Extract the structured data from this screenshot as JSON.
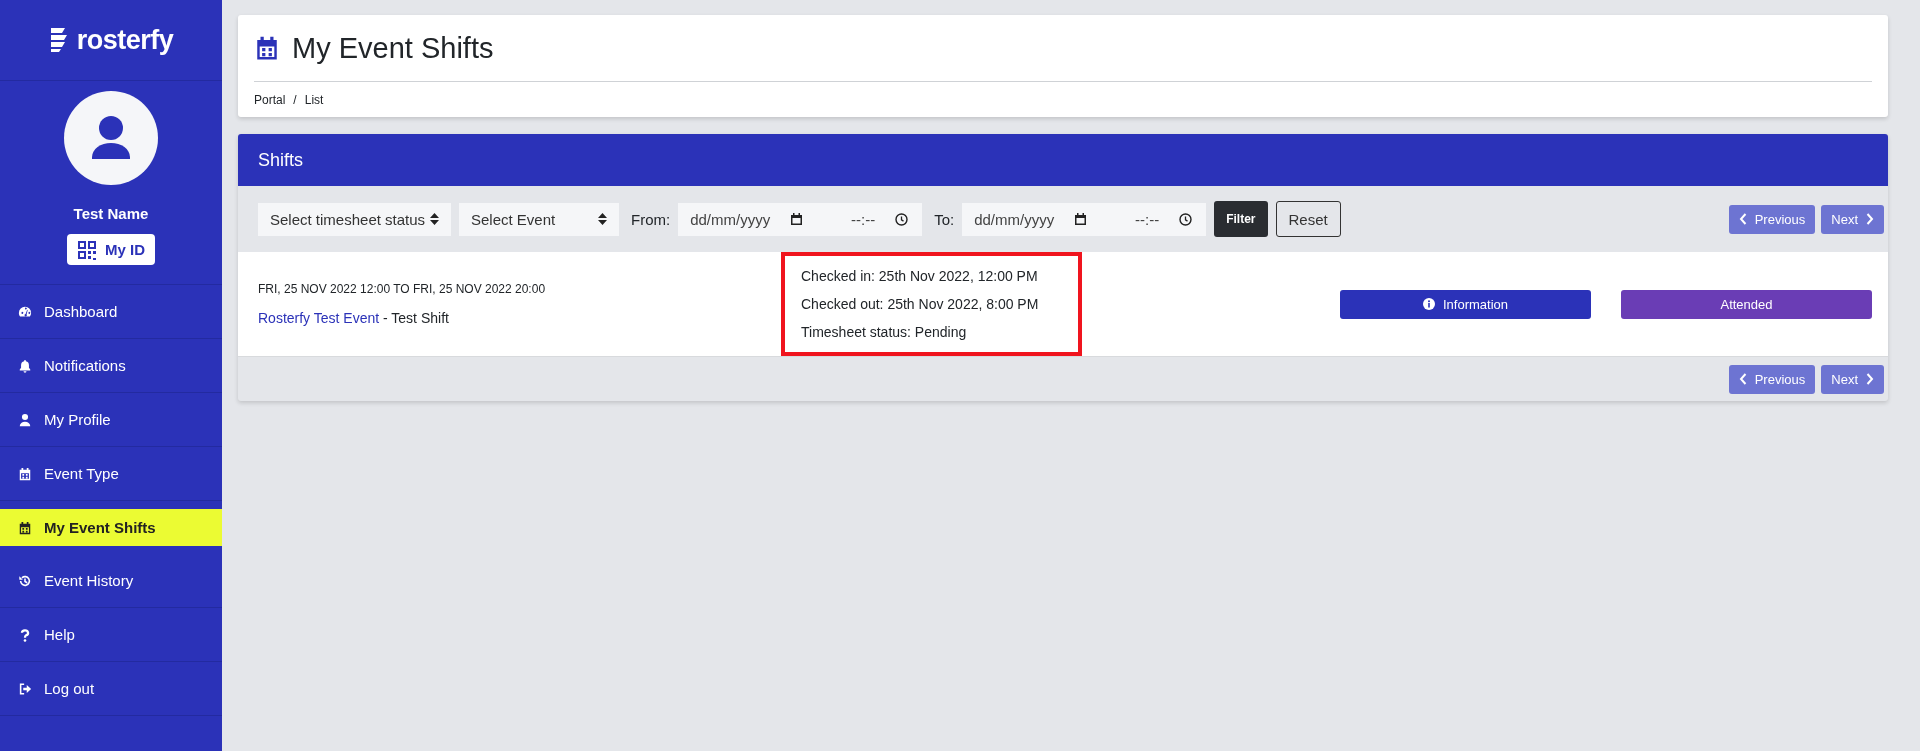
{
  "logo": {
    "text": "rosterfy"
  },
  "user": {
    "name": "Test Name",
    "id_button": "My ID"
  },
  "nav": [
    {
      "label": "Dashboard",
      "kind": "gauge",
      "selected": false
    },
    {
      "label": "Notifications",
      "kind": "bell",
      "selected": false
    },
    {
      "label": "My Profile",
      "kind": "person",
      "selected": false
    },
    {
      "label": "Event Type",
      "kind": "calendar",
      "selected": false
    },
    {
      "label": "My Event Shifts",
      "kind": "calendar",
      "selected": true
    },
    {
      "label": "Event History",
      "kind": "history",
      "selected": false
    },
    {
      "label": "Help",
      "kind": "question",
      "selected": false
    },
    {
      "label": "Log out",
      "kind": "logout",
      "selected": false
    }
  ],
  "page": {
    "title": "My Event Shifts",
    "breadcrumb": [
      "Portal",
      "List"
    ],
    "breadcrumb_separator": "/"
  },
  "panel": {
    "title": "Shifts",
    "filters": {
      "status_select": "Select timesheet status",
      "event_select": "Select Event",
      "from_label": "From:",
      "from_date": "dd/mm/yyyy",
      "from_time": "--:--",
      "to_label": "To:",
      "to_date": "dd/mm/yyyy",
      "to_time": "--:--",
      "filter_button": "Filter",
      "reset_button": "Reset"
    },
    "pagination_top": {
      "previous": "Previous",
      "next": "Next"
    },
    "shifts": [
      {
        "date_range": "FRI, 25 NOV 2022 12:00 TO FRI, 25 NOV 2022 20:00",
        "event_link": "Rosterfy Test Event",
        "shift_name": " - Test Shift",
        "details": [
          "Checked in: 25th Nov 2022, 12:00 PM",
          "Checked out: 25th Nov 2022, 8:00 PM",
          "Timesheet status: Pending"
        ],
        "highlighted": true,
        "info_button": "Information",
        "status_button": "Attended"
      }
    ],
    "pagination_bottom": {
      "previous": "Previous",
      "next": "Next"
    }
  }
}
